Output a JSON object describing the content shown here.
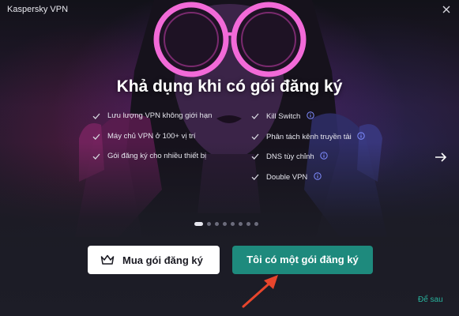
{
  "window": {
    "title": "Kaspersky VPN"
  },
  "hero": {
    "headline": "Khả dụng khi có gói đăng ký"
  },
  "features": {
    "left": [
      {
        "label": "Lưu lượng VPN không giới hạn",
        "info": false
      },
      {
        "label": "Máy chủ VPN ở 100+ vị trí",
        "info": false
      },
      {
        "label": "Gói đăng ký cho nhiều thiết bị",
        "info": false
      }
    ],
    "right": [
      {
        "label": "Kill Switch",
        "info": true
      },
      {
        "label": "Phân tách kênh truyền tải",
        "info": true
      },
      {
        "label": "DNS tùy chỉnh",
        "info": true
      },
      {
        "label": "Double VPN",
        "info": true
      }
    ]
  },
  "carousel": {
    "slide_count": 8,
    "active_index": 0
  },
  "actions": {
    "buy_label": "Mua gói đăng ký",
    "have_label": "Tôi có một gói đăng ký",
    "later_label": "Để sau"
  },
  "icons": {
    "close": "close-icon",
    "check": "check-icon",
    "info": "info-icon",
    "next": "arrow-right-icon",
    "crown": "crown-icon",
    "annotation": "annotation-arrow"
  },
  "colors": {
    "accent": "#1e8a7d",
    "link": "#28b29c",
    "annotation": "#e8452c",
    "info_icon": "#7f8cff",
    "neon": "#f05ad0"
  }
}
